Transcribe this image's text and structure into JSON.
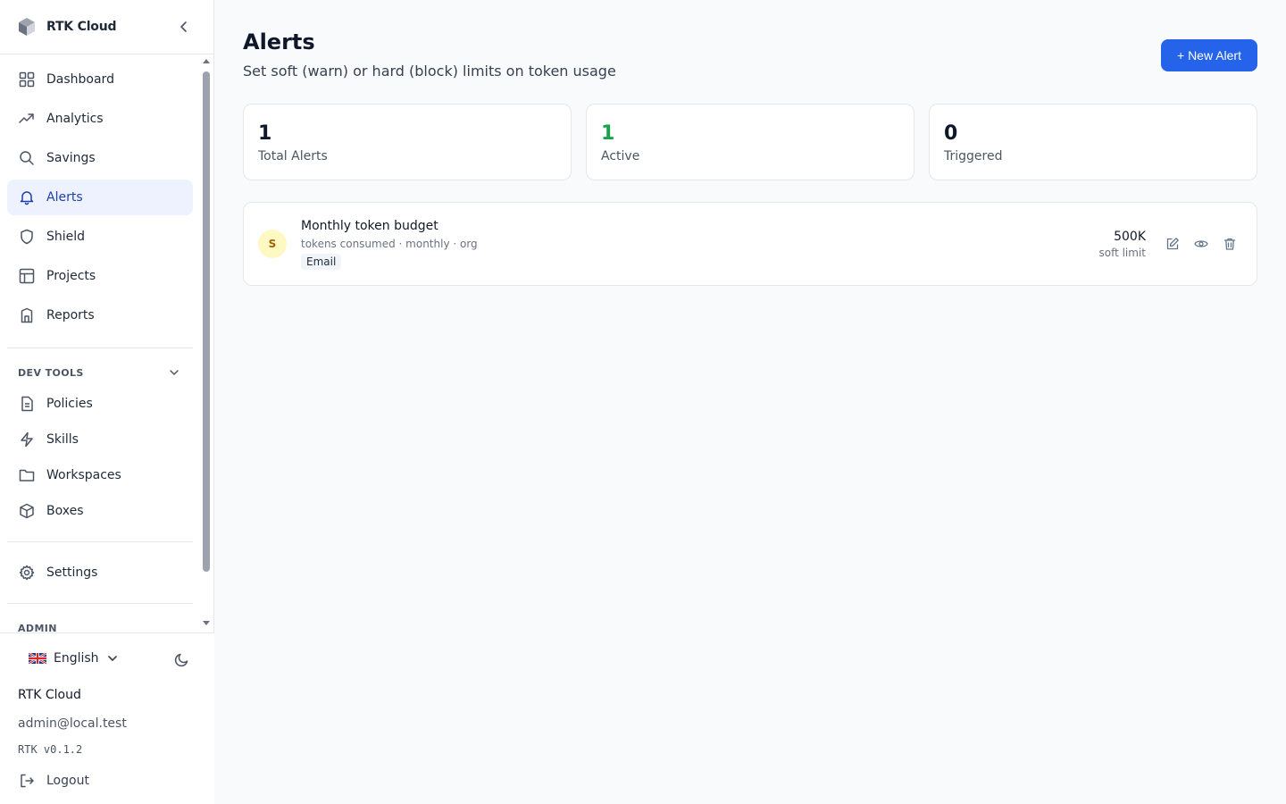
{
  "sidebar": {
    "brand": "RTK Cloud",
    "nav": [
      {
        "label": "Dashboard",
        "icon": "grid-icon"
      },
      {
        "label": "Analytics",
        "icon": "trending-up-icon"
      },
      {
        "label": "Savings",
        "icon": "search-icon"
      },
      {
        "label": "Alerts",
        "icon": "bell-icon",
        "active": true
      },
      {
        "label": "Shield",
        "icon": "shield-icon"
      },
      {
        "label": "Projects",
        "icon": "table-icon"
      },
      {
        "label": "Reports",
        "icon": "report-icon"
      }
    ],
    "dev_tools_label": "DEV TOOLS",
    "dev_tools": [
      {
        "label": "Policies",
        "icon": "document-icon"
      },
      {
        "label": "Skills",
        "icon": "lightning-icon"
      },
      {
        "label": "Workspaces",
        "icon": "folder-icon"
      },
      {
        "label": "Boxes",
        "icon": "box-icon"
      }
    ],
    "settings_label": "Settings",
    "admin_label": "ADMIN",
    "footer": {
      "language": "English",
      "org": "RTK Cloud",
      "email": "admin@local.test",
      "version": "RTK v0.1.2",
      "logout": "Logout"
    }
  },
  "header": {
    "title": "Alerts",
    "subtitle": "Set soft (warn) or hard (block) limits on token usage",
    "new_button": "+ New Alert"
  },
  "stats": [
    {
      "value": "1",
      "label": "Total Alerts",
      "color": "#0f172a"
    },
    {
      "value": "1",
      "label": "Active",
      "color": "#16a34a"
    },
    {
      "value": "0",
      "label": "Triggered",
      "color": "#0f172a"
    }
  ],
  "alerts": [
    {
      "badge": "S",
      "name": "Monthly token budget",
      "meta": "tokens consumed · monthly · org",
      "channel": "Email",
      "limit": "500K",
      "limit_type": "soft limit"
    }
  ],
  "colors": {
    "accent": "#2563eb",
    "active_nav_bg": "#eef2ff",
    "active_nav_text": "#1e40af"
  }
}
